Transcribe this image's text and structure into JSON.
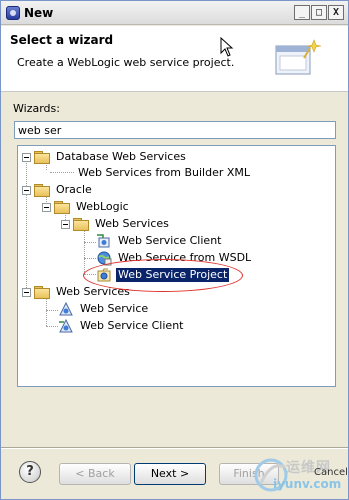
{
  "window": {
    "title": "New",
    "controls": {
      "minimize": "_",
      "maximize": "□",
      "close": "X"
    }
  },
  "header": {
    "title": "Select a wizard",
    "description": "Create a WebLogic web service project."
  },
  "wizards": {
    "label": "Wizards:",
    "filter_value": "web ser"
  },
  "tree": {
    "database_web_services": "Database Web Services",
    "ws_from_builder_xml": "Web Services from Builder XML",
    "oracle": "Oracle",
    "weblogic": "WebLogic",
    "weblogic_web_services": "Web Services",
    "ws_client": "Web Service Client",
    "ws_from_wsdl": "Web Service from WSDL",
    "ws_project": "Web Service Project",
    "web_services": "Web Services",
    "web_service": "Web Service",
    "web_service_client": "Web Service Client"
  },
  "buttons": {
    "help": "?",
    "back": "< Back",
    "next": "Next >",
    "finish": "Finish",
    "cancel": "Cancel"
  },
  "watermark": {
    "line1": "运维网",
    "line2": "iyunv.com"
  },
  "colors": {
    "selection": "#0a246a",
    "annotation": "#e0302a"
  }
}
